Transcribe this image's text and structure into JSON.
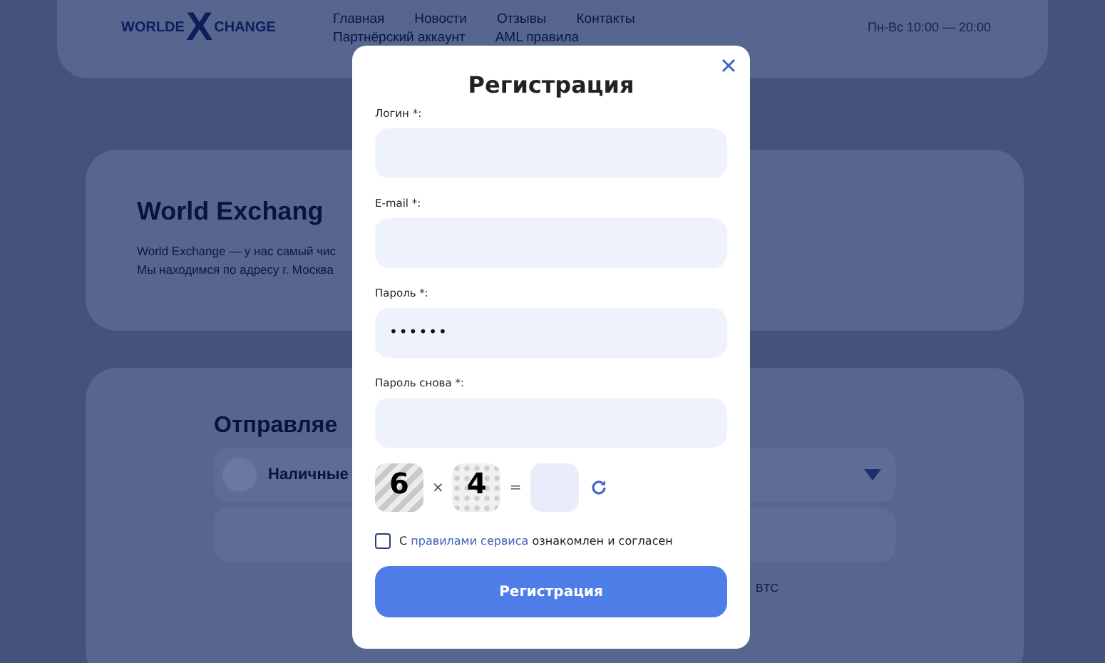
{
  "header": {
    "logo": {
      "left": "WORLDE",
      "mark": "X",
      "right": "CHANGE"
    },
    "nav": [
      "Главная",
      "Новости",
      "Отзывы",
      "Контакты",
      "Партнёрский аккаунт",
      "AML правила"
    ],
    "hours": "Пн-Вс 10:00 — 20:00"
  },
  "about": {
    "title": "World Exchang",
    "lines": [
      "World Exchange — у нас самый чис",
      "Мы находимся по адресу г. Москва"
    ]
  },
  "exchange": {
    "title": "Отправляе",
    "method": "Наличные",
    "currency": "BTC"
  },
  "modal": {
    "title": "Регистрация",
    "fields": [
      {
        "label": "Логин *:"
      },
      {
        "label": "E-mail *:"
      },
      {
        "label": "Пароль *:",
        "value": "••••••"
      },
      {
        "label": "Пароль снова *:"
      }
    ],
    "captcha": {
      "a": "6",
      "op": "×",
      "b": "4",
      "eq": "="
    },
    "agree": {
      "checked": false,
      "before": "С",
      "link": "правилами сервиса",
      "after": "ознакомлен и согласен"
    },
    "button": "Регистрация"
  }
}
